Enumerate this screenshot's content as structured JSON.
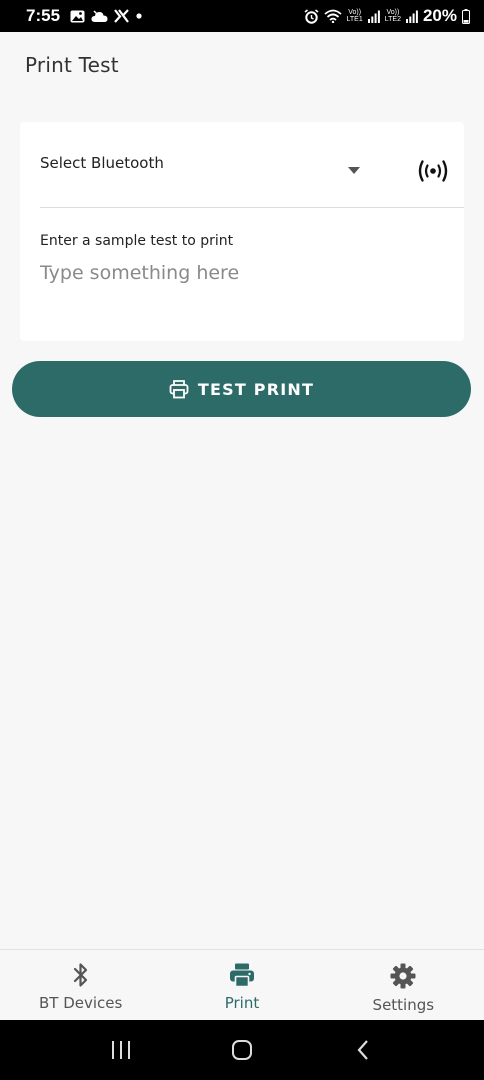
{
  "status_bar": {
    "time": "7:55",
    "battery": "20%",
    "sim1": {
      "top": "Vo))",
      "bottom": "LTE1"
    },
    "sim2": {
      "top": "Vo))",
      "bottom": "LTE2"
    },
    "icons": [
      "gallery-icon",
      "cloud-icon",
      "x-icon",
      "dot-icon",
      "alarm-icon",
      "wifi-icon",
      "signal-icon",
      "battery-icon"
    ]
  },
  "header": {
    "title": "Print Test"
  },
  "bluetooth_select": {
    "label": "Select Bluetooth"
  },
  "sample_input": {
    "label": "Enter a sample test to print",
    "placeholder": "Type something here",
    "value": ""
  },
  "test_print_button": {
    "label": "TEST PRINT"
  },
  "bottom_nav": {
    "items": [
      {
        "label": "BT Devices",
        "icon": "bluetooth-icon",
        "active": false
      },
      {
        "label": "Print",
        "icon": "printer-icon",
        "active": true
      },
      {
        "label": "Settings",
        "icon": "gear-icon",
        "active": false
      }
    ]
  },
  "colors": {
    "accent": "#2d6b69",
    "background": "#f7f7f7",
    "card": "#ffffff"
  }
}
